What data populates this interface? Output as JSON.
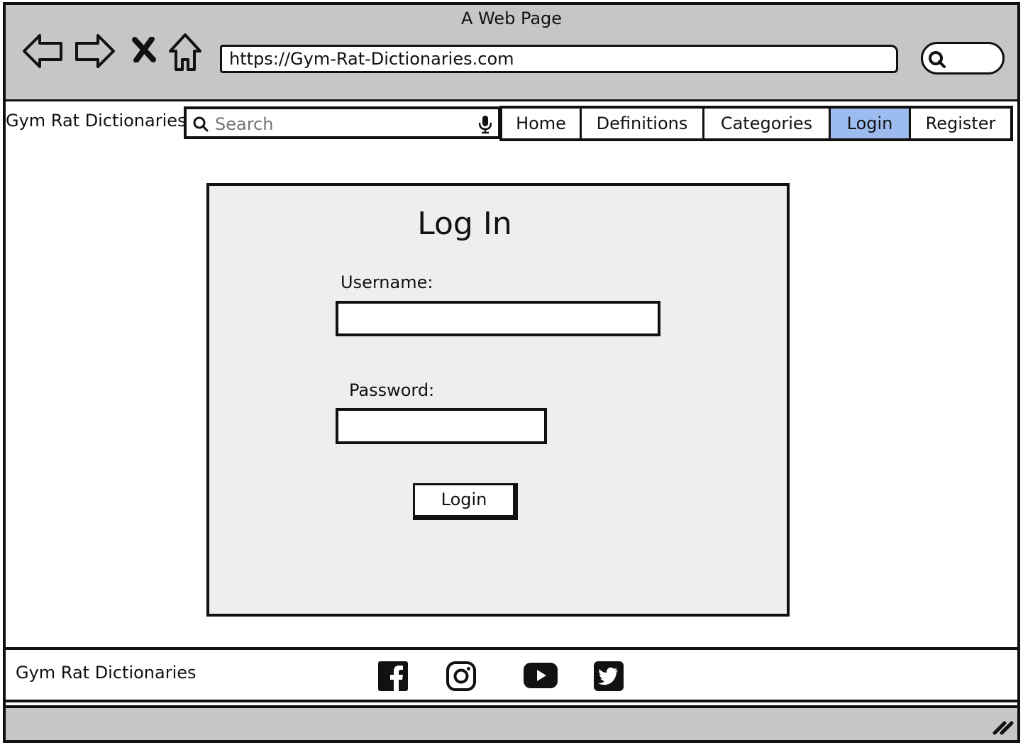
{
  "window": {
    "title": "A Web Page",
    "url": "https://Gym-Rat-Dictionaries.com"
  },
  "browser_icons": [
    "back-arrow-icon",
    "forward-arrow-icon",
    "close-x-icon",
    "home-icon",
    "search-icon"
  ],
  "header": {
    "brand": "Gym Rat Dictionaries",
    "search_placeholder": "Search",
    "nav": [
      {
        "label": "Home",
        "active": false
      },
      {
        "label": "Definitions",
        "active": false
      },
      {
        "label": "Categories",
        "active": false
      },
      {
        "label": "Login",
        "active": true
      },
      {
        "label": "Register",
        "active": false
      }
    ]
  },
  "login": {
    "title": "Log In",
    "username_label": "Username:",
    "username_value": "",
    "password_label": "Password:",
    "password_value": "",
    "button_label": "Login"
  },
  "footer": {
    "brand": "Gym Rat Dictionaries",
    "social_icons": [
      "facebook-icon",
      "instagram-icon",
      "youtube-icon",
      "twitter-icon"
    ]
  },
  "colors": {
    "chrome": "#c6c6c6",
    "panel": "#eeeeee",
    "active_tab": "#9cbcf0"
  }
}
